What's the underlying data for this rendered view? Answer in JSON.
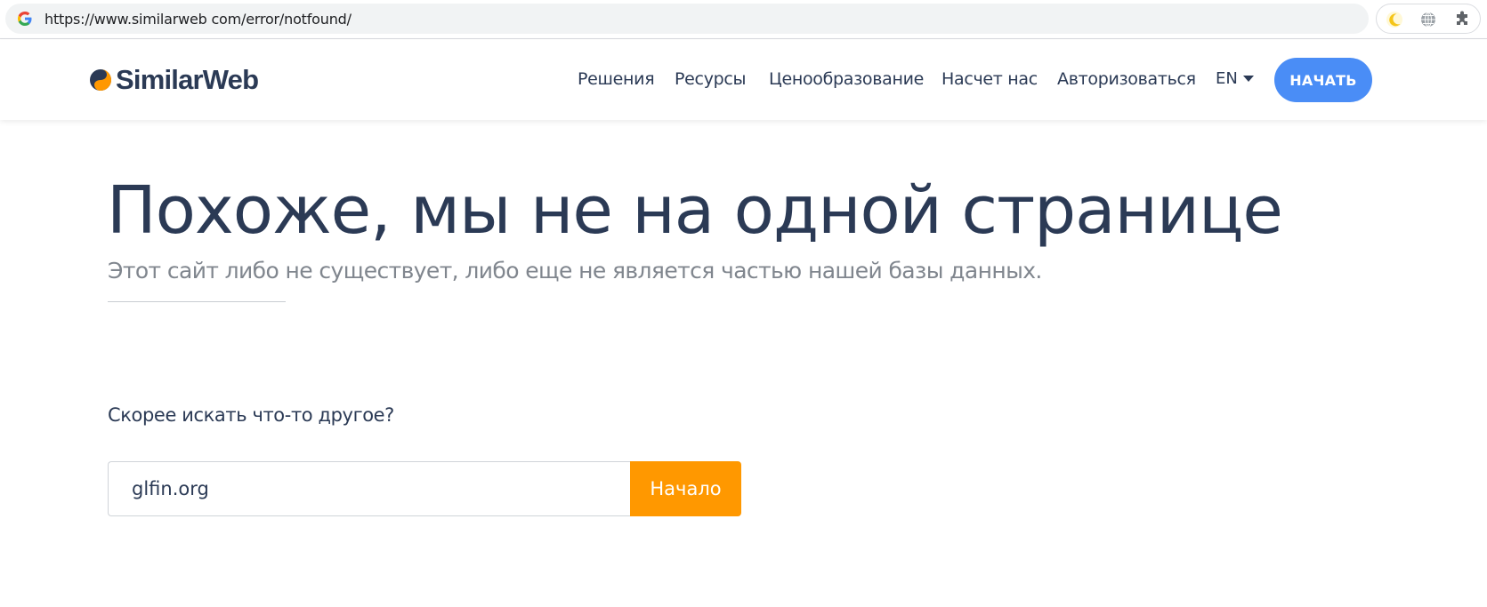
{
  "browser": {
    "url": "https://www.similarweb com/error/notfound/",
    "favicon": "google-g-icon",
    "extensions": [
      "moon-icon",
      "globe-icon",
      "puzzle-icon"
    ]
  },
  "header": {
    "logo_text": "SimilarWeb",
    "nav": [
      {
        "label": "Решения"
      },
      {
        "label": "Ресурсы"
      },
      {
        "label": "Ценообразование"
      },
      {
        "label": "Насчет нас"
      },
      {
        "label": "Авторизоваться"
      }
    ],
    "language": "EN",
    "cta_label": "НАЧАТЬ"
  },
  "main": {
    "headline": "Похоже, мы не на одной странице",
    "subline": "Этот сайт либо не существует, либо еще не является частью нашей базы данных.",
    "search_prompt": "Скорее искать что-то другое?",
    "search_value": "glfin.org",
    "search_button": "Начало"
  },
  "colors": {
    "brand_navy": "#2b3a55",
    "brand_orange": "#ff9800",
    "cta_blue": "#4a8df6",
    "muted_text": "#80868e"
  }
}
